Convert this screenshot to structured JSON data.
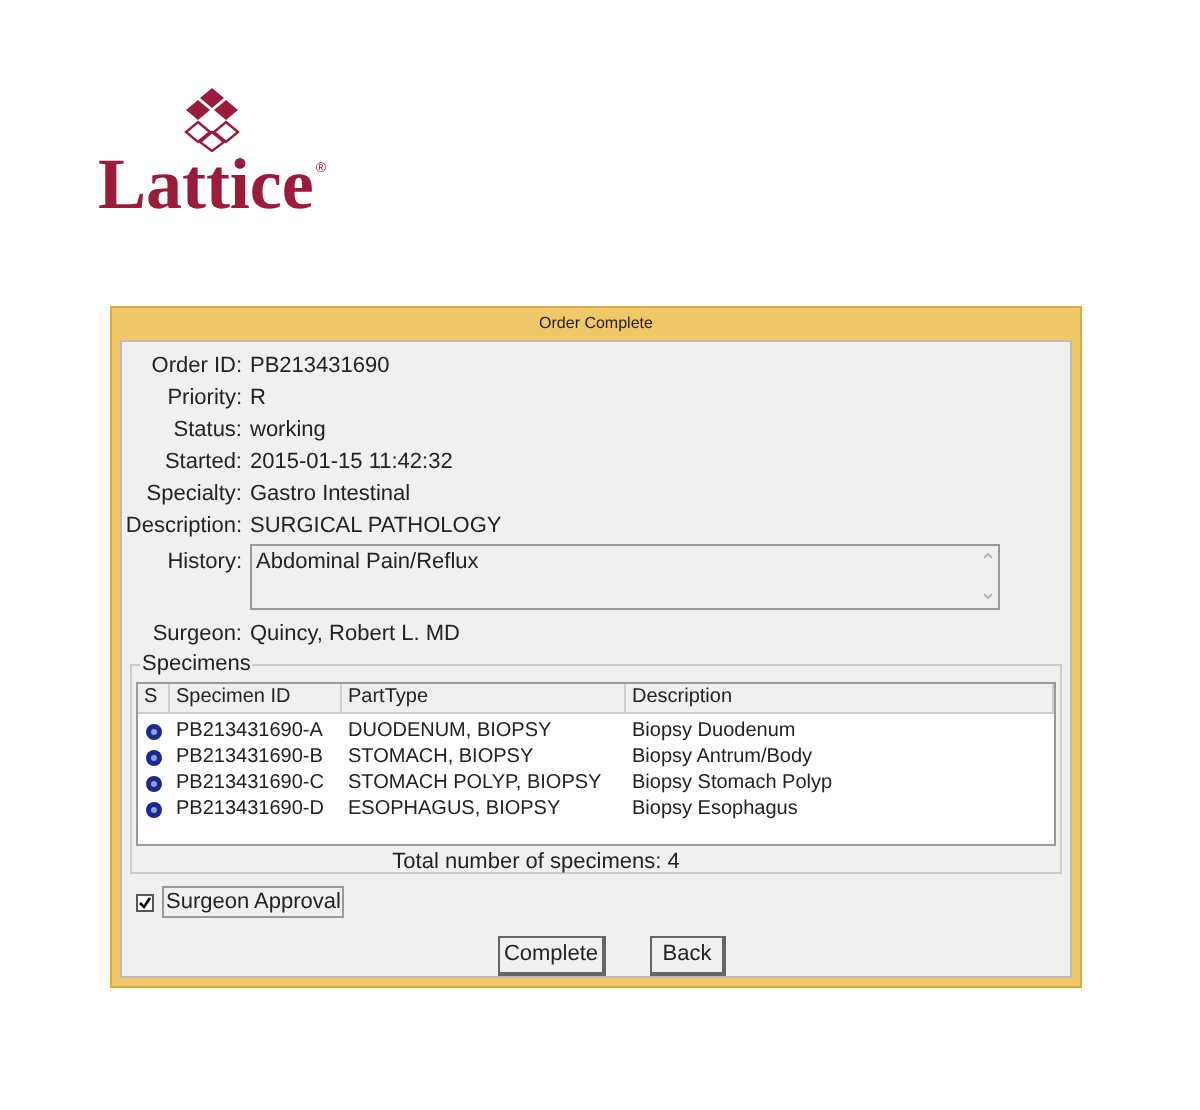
{
  "logo": {
    "name": "Lattice",
    "mark": "®"
  },
  "window": {
    "title": "Order Complete"
  },
  "fields": [
    {
      "label": "Order ID:",
      "value": "PB213431690"
    },
    {
      "label": "Priority:",
      "value": "R"
    },
    {
      "label": "Status:",
      "value": "working"
    },
    {
      "label": "Started:",
      "value": "2015-01-15 11:42:32"
    },
    {
      "label": "Specialty:",
      "value": "Gastro Intestinal"
    },
    {
      "label": "Description:",
      "value": "SURGICAL PATHOLOGY"
    }
  ],
  "history": {
    "label": "History:",
    "value": "Abdominal Pain/Reflux"
  },
  "surgeon": {
    "label": "Surgeon:",
    "value": "Quincy, Robert L. MD"
  },
  "specimens": {
    "title": "Specimens",
    "columns": [
      "S",
      "Specimen ID",
      "PartType",
      "Description"
    ],
    "rows": [
      {
        "id": "PB213431690-A",
        "part_type": "DUODENUM, BIOPSY",
        "description": "Biopsy Duodenum"
      },
      {
        "id": "PB213431690-B",
        "part_type": "STOMACH, BIOPSY",
        "description": "Biopsy Antrum/Body"
      },
      {
        "id": "PB213431690-C",
        "part_type": "STOMACH POLYP, BIOPSY",
        "description": "Biopsy Stomach Polyp"
      },
      {
        "id": "PB213431690-D",
        "part_type": "ESOPHAGUS, BIOPSY",
        "description": "Biopsy Esophagus"
      }
    ],
    "total": "Total number of specimens: 4"
  },
  "approval": {
    "label": "Surgeon Approval",
    "checked": true
  },
  "buttons": [
    "Complete",
    "Back"
  ]
}
